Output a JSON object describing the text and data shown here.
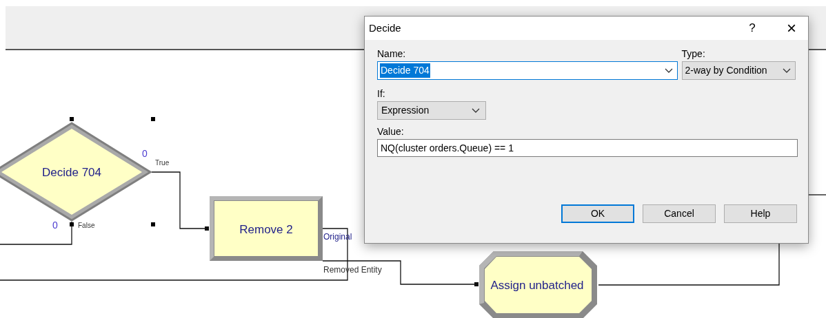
{
  "diagram": {
    "nodes": [
      {
        "kind": "decide",
        "label": "Decide 704",
        "selected": true,
        "counters": [
          "0",
          "0"
        ],
        "ports": [
          "True",
          "False"
        ]
      },
      {
        "kind": "process",
        "label": "Remove 2",
        "selected": false,
        "ports": [
          "Original",
          "Removed Entity"
        ]
      },
      {
        "kind": "assign",
        "label": "Assign unbatched",
        "selected": false
      }
    ]
  },
  "dialog": {
    "title": "Decide",
    "help": "?",
    "close": "×",
    "name": {
      "label": "Name:",
      "value": "Decide 704",
      "text_selected": true
    },
    "type": {
      "label": "Type:",
      "value": "2-way by Condition"
    },
    "if": {
      "label": "If:",
      "value": "Expression"
    },
    "value": {
      "label": "Value:",
      "value": "NQ(cluster orders.Queue) == 1"
    },
    "buttons": [
      {
        "label": "OK",
        "default": true
      },
      {
        "label": "Cancel",
        "default": false
      },
      {
        "label": "Help",
        "default": false
      }
    ]
  }
}
